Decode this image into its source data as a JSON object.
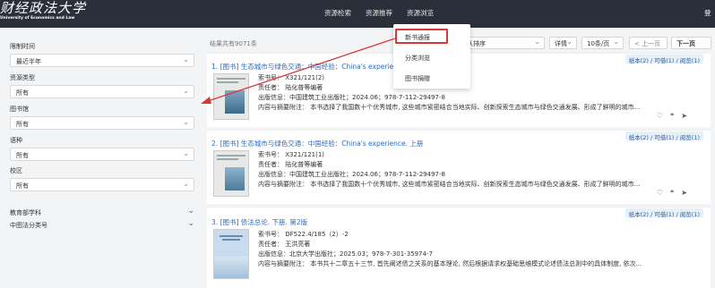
{
  "header": {
    "logo_cn": "财经政法大学",
    "logo_en": "University of Economics and Law",
    "nav": [
      "资源检索",
      "资源推荐",
      "资源浏览"
    ],
    "user_glyph": "登"
  },
  "dropdown": [
    "新书通报",
    "分类浏览",
    "图书捐赠"
  ],
  "sidebar": {
    "filters": [
      {
        "label": "限制时间",
        "value": "最近半年"
      },
      {
        "label": "资源类型",
        "value": "所有"
      },
      {
        "label": "图书馆",
        "value": "所有"
      },
      {
        "label": "语种",
        "value": "所有"
      },
      {
        "label": "校区",
        "value": "所有"
      }
    ],
    "collapsibles": [
      "教育部学科",
      "中图法分类号"
    ]
  },
  "toolbar": {
    "total": "结果共有9071条",
    "sort": "默认排序",
    "detail": "详情",
    "per_page": "10条/页",
    "prev": "< 上一页",
    "next": "下一页"
  },
  "results": [
    {
      "holdings": "纸本(2) / 可借(1) / 阅览(1)",
      "prefix": "1. [图书] ",
      "title": "生态城市与绿色交通：中国经验：China's experience. 下册",
      "call_no": "索书号：  X321/121(2)",
      "author": "责任者：  陆化普等编著",
      "pub": "出版信息：中国建筑工业出版社；2024.06；978-7-112-29497-8",
      "abstract": "内容与摘要附注：  本书选择了我国数十个优秀城市, 这些城市紧密结合当地实际、创新探索生态城市与绿色交通发展、形成了鲜明的城市..."
    },
    {
      "holdings": "纸本(2) / 可借(1) / 阅览(1)",
      "prefix": "2. [图书] ",
      "title": "生态城市与绿色交通：中国经验：China's experience. 上册",
      "call_no": "索书号：  X321/121(1)",
      "author": "责任者：  陆化普等编著",
      "pub": "出版信息：中国建筑工业出版社；2024.06；978-7-112-29497-8",
      "abstract": "内容与摘要附注：  本书选择了我国数十个优秀城市, 这些城市紧密结合当地实际、创新探索生态城市与绿色交通发展、形成了鲜明的城市..."
    },
    {
      "holdings": "纸本(2) / 可借(1) / 阅览(1)",
      "prefix": "3. [图书] ",
      "title": "债法总论. 下册. 第2版",
      "call_no": "索书号：  DF522.4/185（2）-2",
      "author": "责任者：  王洪亮著",
      "pub": "出版信息：北京大学出版社；2025.03；978-7-301-35974-7",
      "abstract": "内容与摘要附注：  本书共十二章五十三节, 首先阐述债之关系的基本理论, 然后根据请求权基础思维模式论述债法总则中的具体制度, 依次..."
    }
  ],
  "action_icons": [
    "heart-icon",
    "quote-icon",
    "send-icon"
  ],
  "colors": {
    "header_bg": "#2b2f3a",
    "link": "#2b6cc4",
    "highlight_box": "#d93838"
  }
}
